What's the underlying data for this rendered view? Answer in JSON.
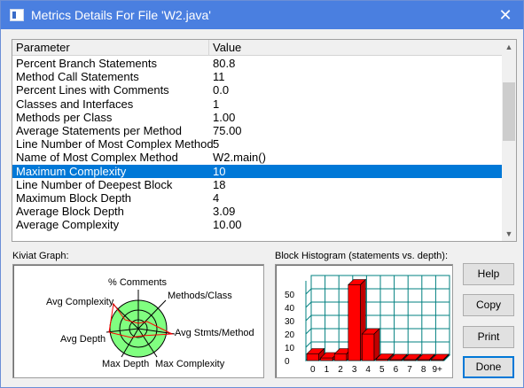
{
  "window": {
    "title": "Metrics Details For File 'W2.java'",
    "close_glyph": "✕"
  },
  "table": {
    "headers": {
      "parameter": "Parameter",
      "value": "Value"
    },
    "rows": [
      {
        "param": "Percent Branch Statements",
        "value": "80.8"
      },
      {
        "param": "Method Call Statements",
        "value": "11"
      },
      {
        "param": "Percent Lines with Comments",
        "value": "0.0"
      },
      {
        "param": "Classes and Interfaces",
        "value": "1"
      },
      {
        "param": "Methods per Class",
        "value": "1.00"
      },
      {
        "param": "Average Statements per Method",
        "value": "75.00"
      },
      {
        "param": "Line Number of Most Complex Method",
        "value": "5"
      },
      {
        "param": "Name of Most Complex Method",
        "value": "W2.main()"
      },
      {
        "param": "Maximum Complexity",
        "value": "10",
        "selected": true
      },
      {
        "param": "Line Number of Deepest Block",
        "value": "18"
      },
      {
        "param": "Maximum Block Depth",
        "value": "4"
      },
      {
        "param": "Average Block Depth",
        "value": "3.09"
      },
      {
        "param": "Average Complexity",
        "value": "10.00"
      }
    ],
    "selection_color": "#0078d7"
  },
  "kiviat": {
    "label": "Kiviat Graph:",
    "axes": [
      "% Comments",
      "Methods/Class",
      "Avg Stmts/Method",
      "Max Complexity",
      "Max Depth",
      "Avg Depth",
      "Avg Complexity"
    ]
  },
  "histogram": {
    "label": "Block Histogram (statements vs. depth):",
    "y_ticks": [
      "0",
      "10",
      "20",
      "30",
      "40",
      "50"
    ],
    "x_labels": [
      "0",
      "1",
      "2",
      "3",
      "4",
      "5",
      "6",
      "7",
      "8",
      "9+"
    ],
    "values": [
      5,
      2,
      5,
      57,
      20,
      1,
      0,
      0,
      0,
      0
    ],
    "bar_color": "#ff0000",
    "grid_color": "#008080"
  },
  "buttons": {
    "help": "Help",
    "copy": "Copy",
    "print": "Print",
    "done": "Done"
  }
}
